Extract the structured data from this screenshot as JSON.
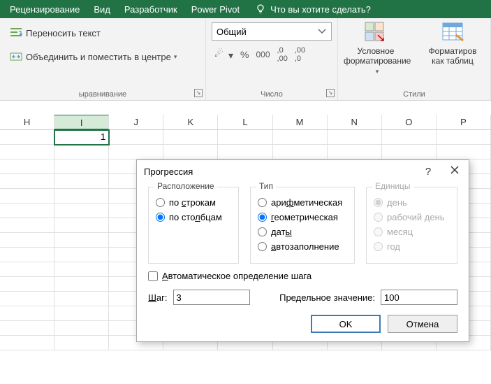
{
  "menubar": {
    "items": [
      "Рецензирование",
      "Вид",
      "Разработчик",
      "Power Pivot"
    ],
    "tell_me": "Что вы хотите сделать?"
  },
  "ribbon": {
    "align": {
      "wrap_text": "Переносить текст",
      "merge_center": "Объединить и поместить в центре",
      "group_label": "ыравнивание"
    },
    "number": {
      "format_combo": "Общий",
      "group_label": "Число"
    },
    "styles": {
      "cond_fmt_line1": "Условное",
      "cond_fmt_line2": "форматирование",
      "as_table_line1": "Форматиров",
      "as_table_line2": "как таблиц",
      "group_label": "Стили"
    }
  },
  "sheet": {
    "columns": [
      "H",
      "I",
      "J",
      "K",
      "L",
      "M",
      "N",
      "O",
      "P"
    ],
    "selected_col": "I",
    "active_value": "1"
  },
  "dialog": {
    "title": "Прогрессия",
    "groups": {
      "layout": {
        "title": "Расположение",
        "rows": "по строкам",
        "cols": "по столбцам"
      },
      "type": {
        "title": "Тип",
        "arith": "арифметическая",
        "geom": "геометрическая",
        "dates": "даты",
        "autofill": "автозаполнение"
      },
      "units": {
        "title": "Единицы",
        "day": "день",
        "workday": "рабочий день",
        "month": "месяц",
        "year": "год"
      }
    },
    "auto_step": "Автоматическое определение шага",
    "step_label": "Шаг:",
    "step_value": "3",
    "limit_label": "Предельное значение:",
    "limit_value": "100",
    "ok": "OK",
    "cancel": "Отмена"
  }
}
